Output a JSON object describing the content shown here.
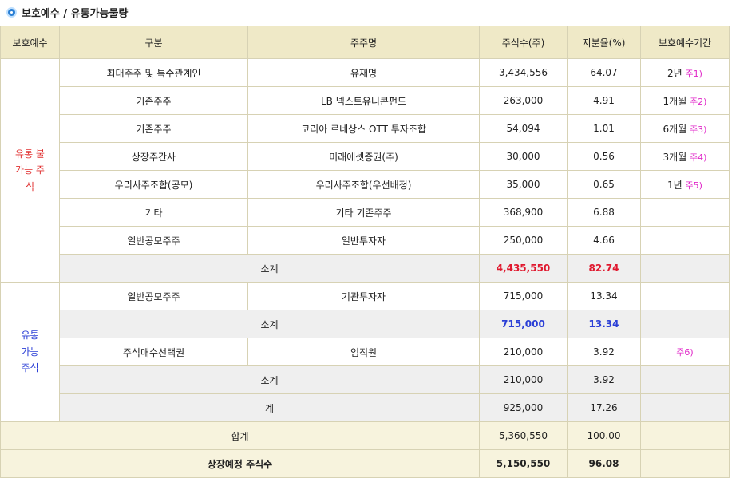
{
  "title": "보호예수 / 유통가능물량",
  "header": {
    "col_lockup": "보호예수",
    "col_category": "구분",
    "col_holder": "주주명",
    "col_shares": "주식수(주)",
    "col_ratio": "지분율(%)",
    "col_period": "보호예수기간"
  },
  "groups": {
    "non_tradable_label": "유통 불가능 주식",
    "tradable_label": "유통 가능 주식"
  },
  "rows": [
    {
      "category": "최대주주 및 특수관계인",
      "holder": "유재명",
      "shares": "3,434,556",
      "ratio": "64.07",
      "period": "2년",
      "note": "주1)"
    },
    {
      "category": "기존주주",
      "holder": "LB 넥스트유니콘펀드",
      "shares": "263,000",
      "ratio": "4.91",
      "period": "1개월",
      "note": "주2)"
    },
    {
      "category": "기존주주",
      "holder": "코리아 르네상스 OTT 투자조합",
      "shares": "54,094",
      "ratio": "1.01",
      "period": "6개월",
      "note": "주3)"
    },
    {
      "category": "상장주간사",
      "holder": "미래에셋증권(주)",
      "shares": "30,000",
      "ratio": "0.56",
      "period": "3개월",
      "note": "주4)"
    },
    {
      "category": "우리사주조합(공모)",
      "holder": "우리사주조합(우선배정)",
      "shares": "35,000",
      "ratio": "0.65",
      "period": "1년",
      "note": "주5)"
    },
    {
      "category": "기타",
      "holder": "기타 기존주주",
      "shares": "368,900",
      "ratio": "6.88",
      "period": "",
      "note": ""
    },
    {
      "category": "일반공모주주",
      "holder": "일반투자자",
      "shares": "250,000",
      "ratio": "4.66",
      "period": "",
      "note": ""
    }
  ],
  "subtotal1": {
    "label": "소계",
    "shares": "4,435,550",
    "ratio": "82.74"
  },
  "tradable_row1": {
    "category": "일반공모주주",
    "holder": "기관투자자",
    "shares": "715,000",
    "ratio": "13.34"
  },
  "subtotal2": {
    "label": "소계",
    "shares": "715,000",
    "ratio": "13.34"
  },
  "tradable_row2": {
    "category": "주식매수선택권",
    "holder": "임직원",
    "shares": "210,000",
    "ratio": "3.92",
    "note": "주6)"
  },
  "subtotal3": {
    "label": "소계",
    "shares": "210,000",
    "ratio": "3.92"
  },
  "tradable_total": {
    "label": "계",
    "shares": "925,000",
    "ratio": "17.26"
  },
  "grand_total": {
    "label": "합계",
    "shares": "5,360,550",
    "ratio": "100.00"
  },
  "listing_total": {
    "label": "상장예정 주식수",
    "shares": "5,150,550",
    "ratio": "96.08"
  },
  "colors": {
    "header_bg": "#efe9c7",
    "subtotal_bg": "#efefef",
    "total_bg": "#f7f3dd",
    "red": "#e0182e",
    "blue": "#2b3fd6",
    "note": "#e026c8"
  }
}
